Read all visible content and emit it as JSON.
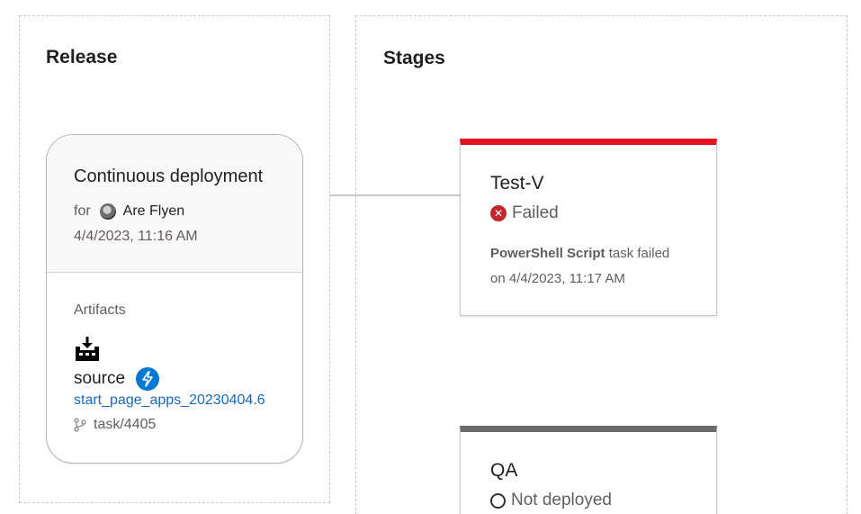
{
  "release": {
    "heading": "Release",
    "trigger": {
      "title": "Continuous deployment",
      "for_label": "for",
      "user": "Are Flyen",
      "date": "4/4/2023, 11:16 AM"
    },
    "artifacts": {
      "label": "Artifacts",
      "icon": "build-artifact-icon",
      "source_name": "source",
      "ci_badge_icon": "lightning-bolt-icon",
      "build_name": "start_page_apps_20230404.6",
      "branch_icon": "branch-icon",
      "branch": "task/4405"
    }
  },
  "stages": {
    "heading": "Stages",
    "items": [
      {
        "name": "Test-V",
        "status": "Failed",
        "status_icon": "failed-x-icon",
        "task_name": "PowerShell Script",
        "task_suffix": " task failed",
        "task_date": "on 4/4/2023, 11:17 AM",
        "accent_color": "#e81123"
      },
      {
        "name": "QA",
        "status": "Not deployed",
        "status_icon": "empty-circle-icon",
        "accent_color": "#6b6b6b"
      }
    ]
  },
  "colors": {
    "link": "#1868b2",
    "ci_badge": "#0078d4",
    "failed": "#c4262e"
  }
}
